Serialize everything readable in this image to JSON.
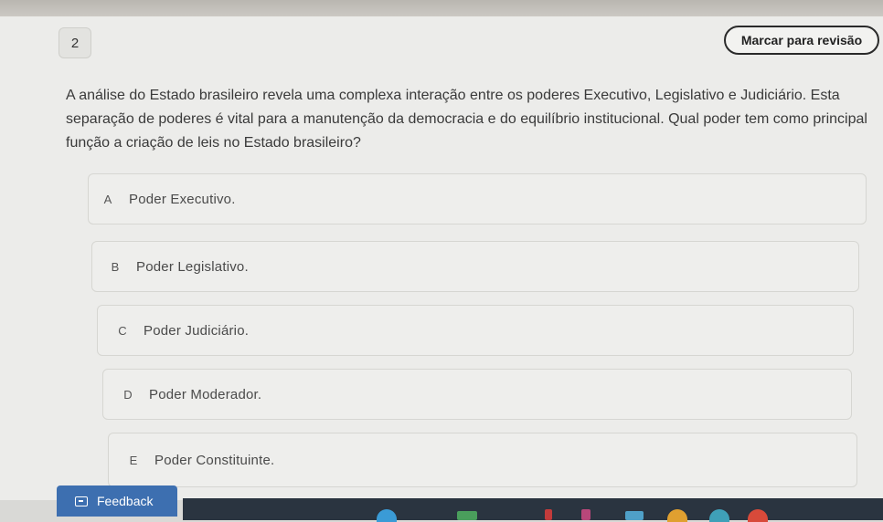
{
  "question": {
    "number": "2",
    "mark_review_label": "Marcar para revisão",
    "text": "A análise do Estado brasileiro revela uma complexa interação entre os poderes Executivo, Legislativo e Judiciário. Esta separação de poderes é vital para a manutenção da democracia e do equilíbrio institucional. Qual poder tem como principal função a criação de leis no Estado brasileiro?"
  },
  "options": [
    {
      "letter": "A",
      "text": "Poder Executivo."
    },
    {
      "letter": "B",
      "text": "Poder Legislativo."
    },
    {
      "letter": "C",
      "text": "Poder Judiciário."
    },
    {
      "letter": "D",
      "text": "Poder Moderador."
    },
    {
      "letter": "E",
      "text": "Poder Constituinte."
    }
  ],
  "feedback": {
    "label": "Feedback"
  },
  "colors": {
    "feedback_bg": "#3d6fb0",
    "taskbar_bg": "#2a3440"
  }
}
